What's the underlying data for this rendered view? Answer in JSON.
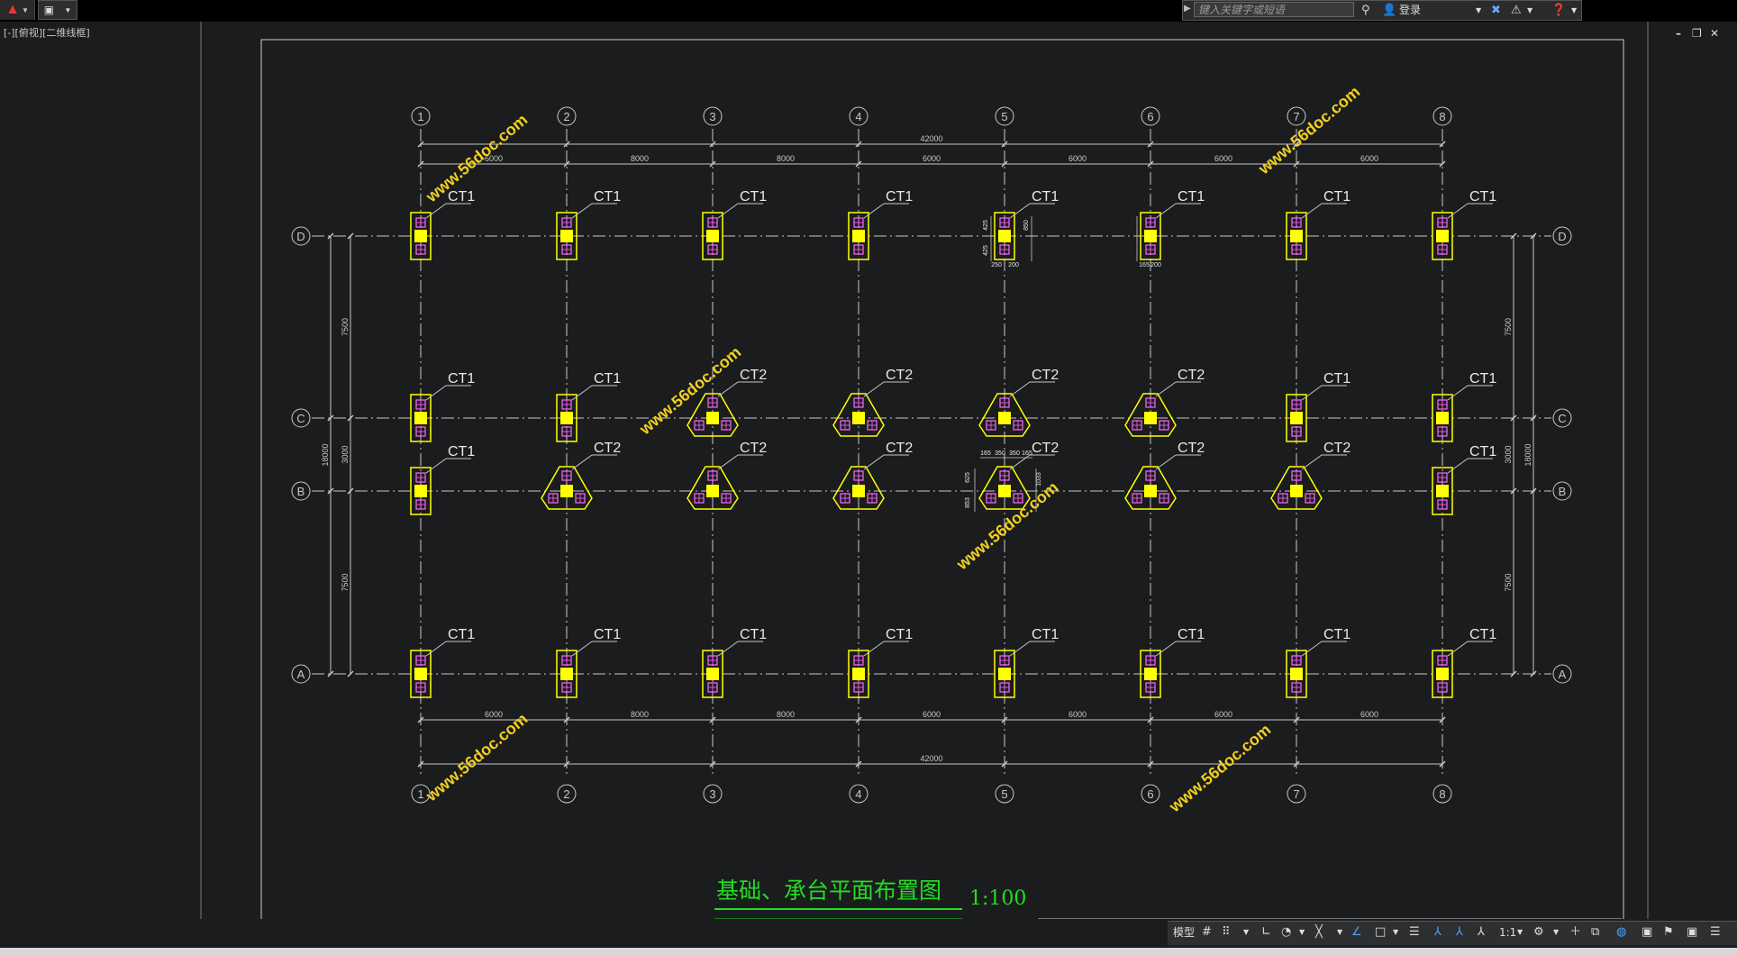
{
  "window": {
    "viewport_label": "[-][俯视][二维线框]",
    "search_placeholder": "键入关键字或短语",
    "login_label": "登录",
    "minimize": "–",
    "restore": "❐",
    "close": "✕"
  },
  "statusbar": {
    "model_label": "模型",
    "scale_label": "1:1"
  },
  "drawing": {
    "title": "基础、承台平面布置图",
    "scale": "1:100",
    "axes_x": [
      "1",
      "2",
      "3",
      "4",
      "5",
      "6",
      "7",
      "8"
    ],
    "axes_y": [
      "D",
      "C",
      "B",
      "A"
    ],
    "span_labels": [
      "6000",
      "8000",
      "8000",
      "6000",
      "6000",
      "6000",
      "6000"
    ],
    "total_x": "42000",
    "span_y": [
      "7500",
      "3000",
      "7500"
    ],
    "total_y": "18000",
    "cap_grid": [
      [
        "CT1",
        "CT1",
        "CT1",
        "CT1",
        "CT1",
        "CT1",
        "CT1",
        "CT1"
      ],
      [
        "CT1",
        "CT1",
        "CT2",
        "CT2",
        "CT2",
        "CT2",
        "CT1",
        "CT1"
      ],
      [
        "CT1",
        "CT2",
        "CT2",
        "CT2",
        "CT2",
        "CT2",
        "CT2",
        "CT1"
      ],
      [
        "CT1",
        "CT1",
        "CT1",
        "CT1",
        "CT1",
        "CT1",
        "CT1",
        "CT1"
      ]
    ],
    "detail_dims": [
      "425",
      "850",
      "425",
      "250",
      "200",
      "200",
      "165",
      "350",
      "350",
      "165",
      "1033",
      "625",
      "853"
    ],
    "watermark": "www.56doc.com"
  },
  "colors": {
    "background": "#1b1c1e",
    "grid": "#c8c8c8",
    "cap": "#ffff00",
    "pile": "#ff66ff",
    "title": "#22dd22"
  }
}
